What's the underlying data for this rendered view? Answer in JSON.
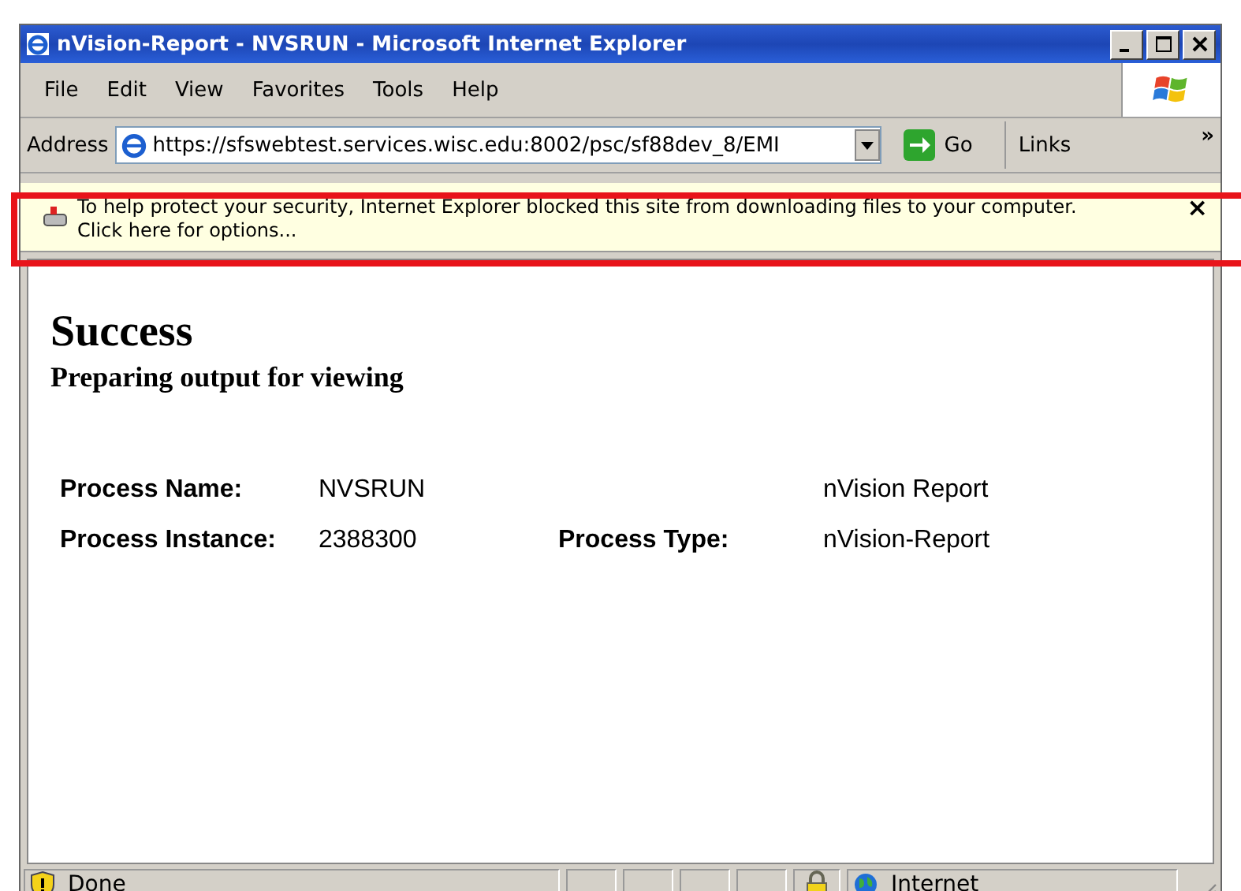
{
  "window": {
    "title": "nVision-Report - NVSRUN - Microsoft Internet Explorer"
  },
  "menu": [
    "File",
    "Edit",
    "View",
    "Favorites",
    "Tools",
    "Help"
  ],
  "address_bar": {
    "label": "Address",
    "value": "https://sfswebtest.services.wisc.edu:8002/psc/sf88dev_8/EMI",
    "go": "Go",
    "links": "Links",
    "links_more": "»"
  },
  "info_bar": {
    "text": "To help protect your security, Internet Explorer blocked this site from downloading files to your computer. Click here for options...",
    "close": "×",
    "highlighted": true
  },
  "page": {
    "heading": "Success",
    "subheading": "Preparing output for viewing",
    "fields": [
      {
        "label": "Process Name:",
        "value": "NVSRUN",
        "value_2": "nVision Report"
      },
      {
        "label": "Process Instance:",
        "value": "2388300",
        "label_2": "Process Type:",
        "value_2": "nVision-Report"
      }
    ]
  },
  "status_bar": {
    "text": "Done",
    "zone": "Internet"
  }
}
